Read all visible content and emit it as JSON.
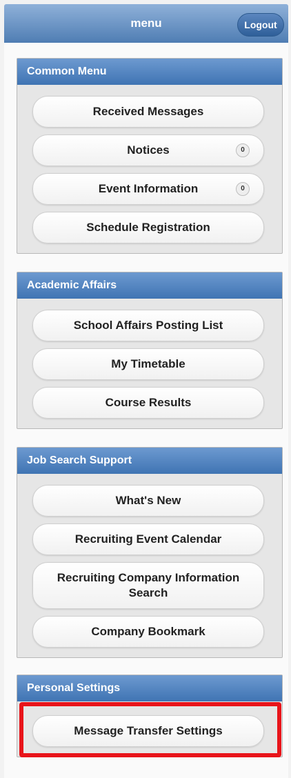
{
  "header": {
    "title": "menu",
    "logout_label": "Logout"
  },
  "sections": [
    {
      "title": "Common Menu",
      "items": [
        {
          "label": "Received Messages"
        },
        {
          "label": "Notices",
          "count": "0"
        },
        {
          "label": "Event Information",
          "count": "0"
        },
        {
          "label": "Schedule Registration"
        }
      ]
    },
    {
      "title": "Academic Affairs",
      "items": [
        {
          "label": "School Affairs Posting List"
        },
        {
          "label": "My Timetable"
        },
        {
          "label": "Course Results"
        }
      ]
    },
    {
      "title": "Job Search Support",
      "items": [
        {
          "label": "What's New"
        },
        {
          "label": "Recruiting Event Calendar"
        },
        {
          "label": "Recruiting Company Information Search"
        },
        {
          "label": "Company Bookmark"
        }
      ]
    },
    {
      "title": "Personal Settings",
      "items": [
        {
          "label": "Message Transfer Settings"
        }
      ]
    }
  ],
  "colors": {
    "header_blue": "#4f7db3",
    "section_blue": "#3f74b3",
    "highlight_red": "#e8141a"
  }
}
